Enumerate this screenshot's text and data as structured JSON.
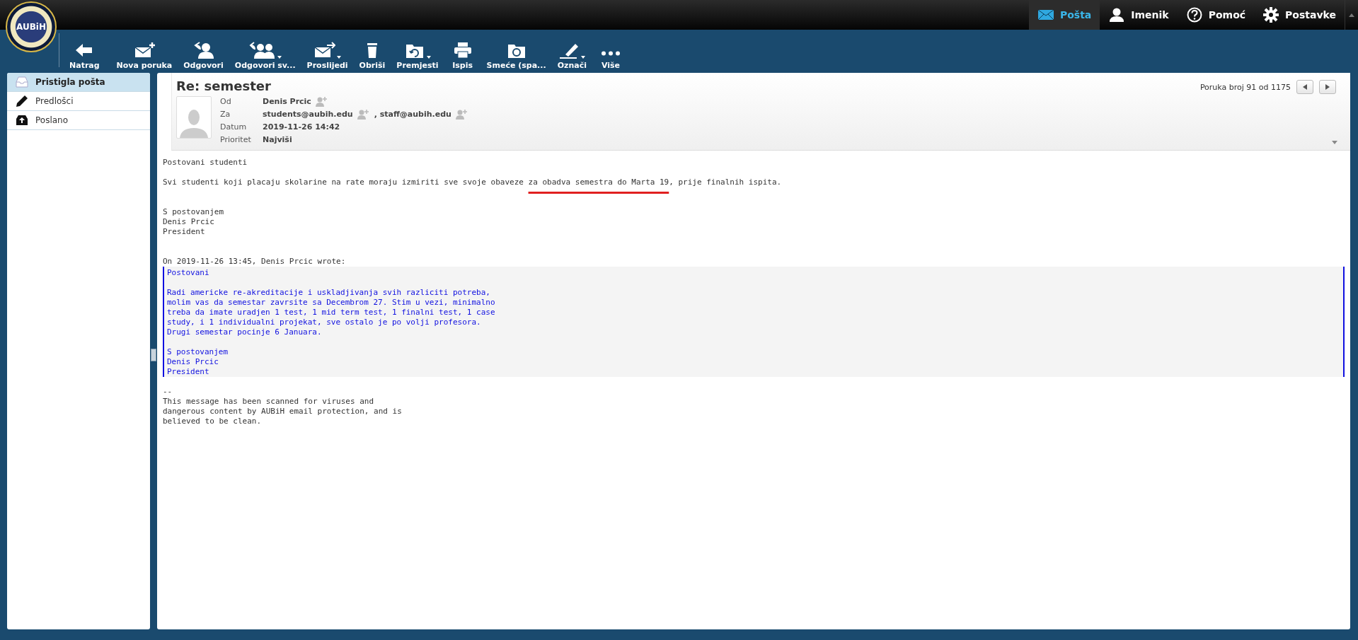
{
  "logo": {
    "text": "AUBiH"
  },
  "top_nav": [
    {
      "label": "Pošta",
      "kind": "mail",
      "selected": true
    },
    {
      "label": "Imenik",
      "kind": "contacts",
      "selected": false
    },
    {
      "label": "Pomoć",
      "kind": "help",
      "selected": false
    },
    {
      "label": "Postavke",
      "kind": "settings",
      "selected": false
    }
  ],
  "toolbar": [
    {
      "label": "Natrag",
      "kind": "back",
      "dropdown": false
    },
    {
      "label": "Nova poruka",
      "kind": "compose",
      "dropdown": false
    },
    {
      "label": "Odgovori",
      "kind": "reply",
      "dropdown": false
    },
    {
      "label": "Odgovori sv...",
      "kind": "reply-all",
      "dropdown": true
    },
    {
      "label": "Proslijedi",
      "kind": "forward",
      "dropdown": true
    },
    {
      "label": "Obriši",
      "kind": "delete",
      "dropdown": false
    },
    {
      "label": "Premjesti",
      "kind": "move",
      "dropdown": true
    },
    {
      "label": "Ispis",
      "kind": "print",
      "dropdown": false
    },
    {
      "label": "Smeće (spa...",
      "kind": "junk",
      "dropdown": false
    },
    {
      "label": "Označi",
      "kind": "mark",
      "dropdown": true
    },
    {
      "label": "Više",
      "kind": "more",
      "dropdown": false
    }
  ],
  "sidebar": {
    "items": [
      {
        "label": "Pristigla pošta",
        "kind": "inbox",
        "selected": true
      },
      {
        "label": "Predlošci",
        "kind": "templates",
        "selected": false
      },
      {
        "label": "Poslano",
        "kind": "sent",
        "selected": false
      }
    ]
  },
  "message": {
    "subject": "Re: semester",
    "counter": "Poruka broj 91 od 1175",
    "headers": [
      {
        "label": "Od",
        "kind": "contacts",
        "values": [
          {
            "text": "Denis Prcic"
          }
        ]
      },
      {
        "label": "Za",
        "kind": "contacts",
        "values": [
          {
            "text": "students@aubih.edu"
          },
          {
            "text": ", staff@aubih.edu"
          }
        ]
      },
      {
        "label": "Datum",
        "kind": "text",
        "values": [
          {
            "text": "2019-11-26 14:42"
          }
        ]
      },
      {
        "label": "Prioritet",
        "kind": "text",
        "values": [
          {
            "text": "Najviši"
          }
        ]
      }
    ],
    "body": [
      {
        "kind": "text",
        "text": "Postovani studenti"
      },
      {
        "kind": "marked",
        "before": "Svi studenti koji placaju skolarine na rate moraju izmiriti sve svoje obaveze ",
        "underlined": "za obadva semestra do Marta 19",
        "after": ", prije finalnih ispita."
      },
      {
        "kind": "text",
        "text": "S postovanjem\nDenis Prcic\nPresident",
        "gap": true
      },
      {
        "kind": "text",
        "text": "On 2019-11-26 13:45, Denis Prcic wrote:",
        "gap": true
      },
      {
        "kind": "quote",
        "paragraphs": [
          "Postovani",
          "Radi americke re-akreditacije i uskladjivanja svih razliciti potreba,\nmolim vas da semestar zavrsite sa Decembrom 27. Stim u vezi, minimalno\ntreba da imate uradjen 1 test, 1 mid term test, 1 finalni test, 1 case\nstudy, i 1 individualni projekat, sve ostalo je po volji profesora.\nDrugi semestar pocinje 6 Januara.",
          "S postovanjem\nDenis Prcic\nPresident"
        ]
      },
      {
        "kind": "text",
        "text": "--\nThis message has been scanned for viruses and\ndangerous content by AUBiH email protection, and is\nbelieved to be clean."
      }
    ]
  }
}
